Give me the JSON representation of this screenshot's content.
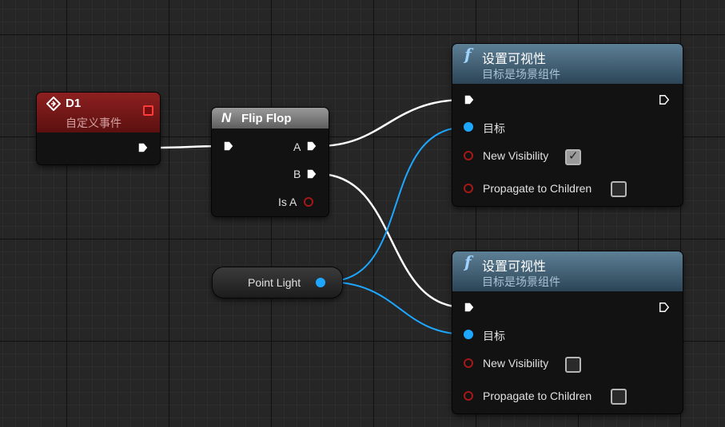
{
  "colors": {
    "exec_wire": "#ffffff",
    "object_wire": "#1ea7ff",
    "bool_pin": "#a41818",
    "event_header": "#8e2020",
    "function_header": "#3d5b70"
  },
  "event_node": {
    "icon": "event-diamond-icon",
    "title": "D1",
    "subtitle": "自定义事件"
  },
  "flipflop_node": {
    "icon": "flipflop-icon",
    "icon_glyph": "N",
    "title": "Flip Flop",
    "pin_a": "A",
    "pin_b": "B",
    "pin_is_a": "Is A"
  },
  "pointlight_node": {
    "label": "Point Light"
  },
  "set_visibility_1": {
    "icon": "function-icon",
    "icon_glyph": "f",
    "title": "设置可视性",
    "subtitle": "目标是场景组件",
    "target_label": "目标",
    "new_visibility_label": "New Visibility",
    "new_visibility_checked": true,
    "propagate_label": "Propagate to Children",
    "propagate_checked": false
  },
  "set_visibility_2": {
    "icon": "function-icon",
    "icon_glyph": "f",
    "title": "设置可视性",
    "subtitle": "目标是场景组件",
    "target_label": "目标",
    "new_visibility_label": "New Visibility",
    "new_visibility_checked": false,
    "propagate_label": "Propagate to Children",
    "propagate_checked": false
  }
}
